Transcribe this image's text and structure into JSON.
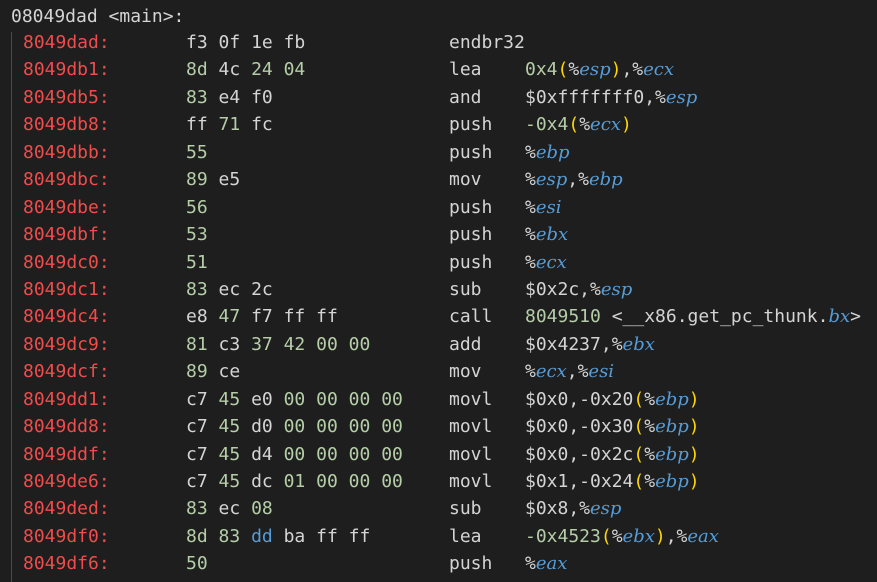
{
  "function_header": "08049dad <main>:",
  "rows": [
    {
      "addr": "8049dad:",
      "bytes": [
        [
          "f3",
          "plain"
        ],
        [
          "0f",
          "plain"
        ],
        [
          "1e",
          "plain"
        ],
        [
          "fb",
          "plain"
        ]
      ],
      "mnemonic": "endbr32",
      "operands": []
    },
    {
      "addr": "8049db1:",
      "bytes": [
        [
          "8d",
          "num"
        ],
        [
          "4c",
          "plain"
        ],
        [
          "24",
          "num"
        ],
        [
          "04",
          "num"
        ]
      ],
      "mnemonic": "lea",
      "operands": [
        [
          "0x4",
          "num"
        ],
        [
          "(",
          "paren"
        ],
        [
          "%",
          "plain"
        ],
        [
          "esp",
          "reg"
        ],
        [
          ")",
          "paren"
        ],
        [
          ",%",
          "plain"
        ],
        [
          "ecx",
          "reg"
        ]
      ]
    },
    {
      "addr": "8049db5:",
      "bytes": [
        [
          "83",
          "num"
        ],
        [
          "e4",
          "plain"
        ],
        [
          "f0",
          "plain"
        ]
      ],
      "mnemonic": "and",
      "operands": [
        [
          "$0xfffffff0,%",
          "plain"
        ],
        [
          "esp",
          "reg"
        ]
      ]
    },
    {
      "addr": "8049db8:",
      "bytes": [
        [
          "ff",
          "plain"
        ],
        [
          "71",
          "num"
        ],
        [
          "fc",
          "plain"
        ]
      ],
      "mnemonic": "push",
      "operands": [
        [
          "-0x4",
          "num"
        ],
        [
          "(",
          "paren"
        ],
        [
          "%",
          "plain"
        ],
        [
          "ecx",
          "reg"
        ],
        [
          ")",
          "paren"
        ]
      ]
    },
    {
      "addr": "8049dbb:",
      "bytes": [
        [
          "55",
          "num"
        ]
      ],
      "mnemonic": "push",
      "operands": [
        [
          "%",
          "plain"
        ],
        [
          "ebp",
          "reg"
        ]
      ]
    },
    {
      "addr": "8049dbc:",
      "bytes": [
        [
          "89",
          "num"
        ],
        [
          "e5",
          "plain"
        ]
      ],
      "mnemonic": "mov",
      "operands": [
        [
          "%",
          "plain"
        ],
        [
          "esp",
          "reg"
        ],
        [
          ",%",
          "plain"
        ],
        [
          "ebp",
          "reg"
        ]
      ]
    },
    {
      "addr": "8049dbe:",
      "bytes": [
        [
          "56",
          "num"
        ]
      ],
      "mnemonic": "push",
      "operands": [
        [
          "%",
          "plain"
        ],
        [
          "esi",
          "reg"
        ]
      ]
    },
    {
      "addr": "8049dbf:",
      "bytes": [
        [
          "53",
          "num"
        ]
      ],
      "mnemonic": "push",
      "operands": [
        [
          "%",
          "plain"
        ],
        [
          "ebx",
          "reg"
        ]
      ]
    },
    {
      "addr": "8049dc0:",
      "bytes": [
        [
          "51",
          "num"
        ]
      ],
      "mnemonic": "push",
      "operands": [
        [
          "%",
          "plain"
        ],
        [
          "ecx",
          "reg"
        ]
      ]
    },
    {
      "addr": "8049dc1:",
      "bytes": [
        [
          "83",
          "num"
        ],
        [
          "ec",
          "plain"
        ],
        [
          "2c",
          "plain"
        ]
      ],
      "mnemonic": "sub",
      "operands": [
        [
          "$0x2c,%",
          "plain"
        ],
        [
          "esp",
          "reg"
        ]
      ]
    },
    {
      "addr": "8049dc4:",
      "bytes": [
        [
          "e8",
          "plain"
        ],
        [
          "47",
          "num"
        ],
        [
          "f7",
          "plain"
        ],
        [
          "ff",
          "plain"
        ],
        [
          "ff",
          "plain"
        ]
      ],
      "mnemonic": "call",
      "operands": [
        [
          "8049510",
          "num"
        ],
        [
          " <__x86.get_pc_thunk.",
          "plain"
        ],
        [
          "bx",
          "reg"
        ],
        [
          ">",
          "plain"
        ]
      ]
    },
    {
      "addr": "8049dc9:",
      "bytes": [
        [
          "81",
          "num"
        ],
        [
          "c3",
          "plain"
        ],
        [
          "37",
          "num"
        ],
        [
          "42",
          "num"
        ],
        [
          "00",
          "num"
        ],
        [
          "00",
          "num"
        ]
      ],
      "mnemonic": "add",
      "operands": [
        [
          "$0x4237,%",
          "plain"
        ],
        [
          "ebx",
          "reg"
        ]
      ]
    },
    {
      "addr": "8049dcf:",
      "bytes": [
        [
          "89",
          "num"
        ],
        [
          "ce",
          "plain"
        ]
      ],
      "mnemonic": "mov",
      "operands": [
        [
          "%",
          "plain"
        ],
        [
          "ecx",
          "reg"
        ],
        [
          ",%",
          "plain"
        ],
        [
          "esi",
          "reg"
        ]
      ]
    },
    {
      "addr": "8049dd1:",
      "bytes": [
        [
          "c7",
          "plain"
        ],
        [
          "45",
          "num"
        ],
        [
          "e0",
          "plain"
        ],
        [
          "00",
          "num"
        ],
        [
          "00",
          "num"
        ],
        [
          "00",
          "num"
        ],
        [
          "00",
          "num"
        ]
      ],
      "mnemonic": "movl",
      "operands": [
        [
          "$0x0,-0x20",
          "plain"
        ],
        [
          "(",
          "paren"
        ],
        [
          "%",
          "plain"
        ],
        [
          "ebp",
          "reg"
        ],
        [
          ")",
          "paren"
        ]
      ]
    },
    {
      "addr": "8049dd8:",
      "bytes": [
        [
          "c7",
          "plain"
        ],
        [
          "45",
          "num"
        ],
        [
          "d0",
          "plain"
        ],
        [
          "00",
          "num"
        ],
        [
          "00",
          "num"
        ],
        [
          "00",
          "num"
        ],
        [
          "00",
          "num"
        ]
      ],
      "mnemonic": "movl",
      "operands": [
        [
          "$0x0,-0x30",
          "plain"
        ],
        [
          "(",
          "paren"
        ],
        [
          "%",
          "plain"
        ],
        [
          "ebp",
          "reg"
        ],
        [
          ")",
          "paren"
        ]
      ]
    },
    {
      "addr": "8049ddf:",
      "bytes": [
        [
          "c7",
          "plain"
        ],
        [
          "45",
          "num"
        ],
        [
          "d4",
          "plain"
        ],
        [
          "00",
          "num"
        ],
        [
          "00",
          "num"
        ],
        [
          "00",
          "num"
        ],
        [
          "00",
          "num"
        ]
      ],
      "mnemonic": "movl",
      "operands": [
        [
          "$0x0,-0x2c",
          "plain"
        ],
        [
          "(",
          "paren"
        ],
        [
          "%",
          "plain"
        ],
        [
          "ebp",
          "reg"
        ],
        [
          ")",
          "paren"
        ]
      ]
    },
    {
      "addr": "8049de6:",
      "bytes": [
        [
          "c7",
          "plain"
        ],
        [
          "45",
          "num"
        ],
        [
          "dc",
          "plain"
        ],
        [
          "01",
          "num"
        ],
        [
          "00",
          "num"
        ],
        [
          "00",
          "num"
        ],
        [
          "00",
          "num"
        ]
      ],
      "mnemonic": "movl",
      "operands": [
        [
          "$0x1,-0x24",
          "plain"
        ],
        [
          "(",
          "paren"
        ],
        [
          "%",
          "plain"
        ],
        [
          "ebp",
          "reg"
        ],
        [
          ")",
          "paren"
        ]
      ]
    },
    {
      "addr": "8049ded:",
      "bytes": [
        [
          "83",
          "num"
        ],
        [
          "ec",
          "plain"
        ],
        [
          "08",
          "num"
        ]
      ],
      "mnemonic": "sub",
      "operands": [
        [
          "$0x8,%",
          "plain"
        ],
        [
          "esp",
          "reg"
        ]
      ]
    },
    {
      "addr": "8049df0:",
      "bytes": [
        [
          "8d",
          "num"
        ],
        [
          "83",
          "num"
        ],
        [
          "dd",
          "blue"
        ],
        [
          "ba",
          "plain"
        ],
        [
          "ff",
          "plain"
        ],
        [
          "ff",
          "plain"
        ]
      ],
      "mnemonic": "lea",
      "operands": [
        [
          "-0x4523",
          "num"
        ],
        [
          "(",
          "paren"
        ],
        [
          "%",
          "plain"
        ],
        [
          "ebx",
          "reg"
        ],
        [
          ")",
          "paren"
        ],
        [
          ",%",
          "plain"
        ],
        [
          "eax",
          "reg"
        ]
      ]
    },
    {
      "addr": "8049df6:",
      "bytes": [
        [
          "50",
          "num"
        ]
      ],
      "mnemonic": "push",
      "operands": [
        [
          "%",
          "plain"
        ],
        [
          "eax",
          "reg"
        ]
      ]
    }
  ],
  "colors": {
    "background": "#1e1e1e",
    "address": "#f14c4c",
    "plain_text": "#d4d4d4",
    "number": "#b5cea8",
    "register": "#569cd6",
    "paren": "#ffd700"
  }
}
